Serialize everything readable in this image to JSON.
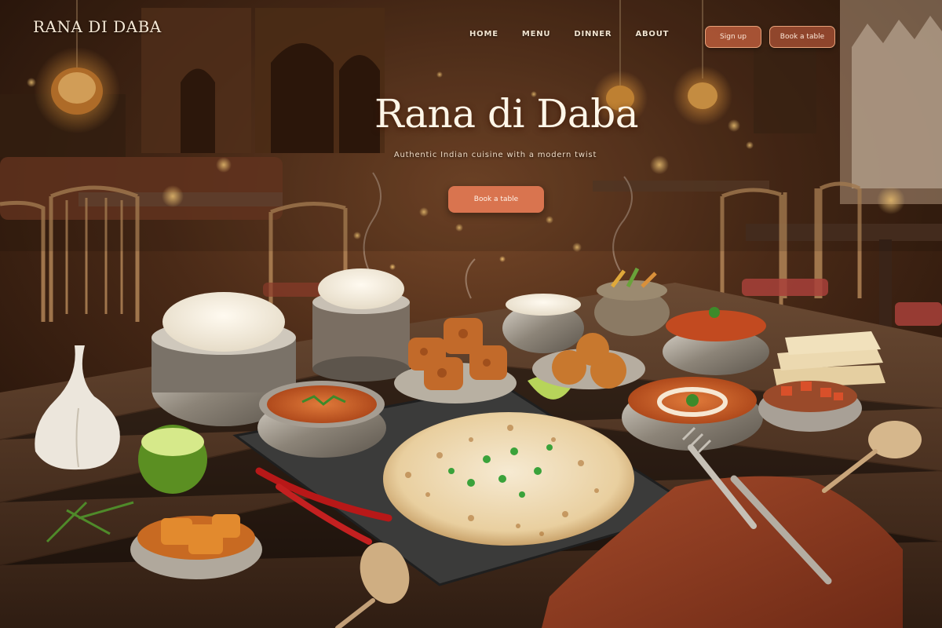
{
  "header": {
    "brand": "RANA DI DABA",
    "nav": [
      {
        "label": "HOME"
      },
      {
        "label": "MENU"
      },
      {
        "label": "DINNER"
      },
      {
        "label": "ABOUT"
      }
    ],
    "signup_label": "Sign up",
    "book_label": "Book a table"
  },
  "hero": {
    "title": "Rana di Daba",
    "subtitle": "Authentic Indian cuisine with a modern twist",
    "cta_label": "Book a table"
  },
  "colors": {
    "accent": "#d9744f",
    "button_outline": "#e8a27a",
    "text_light": "#fff6e8",
    "wood_dark": "#3b2215"
  }
}
